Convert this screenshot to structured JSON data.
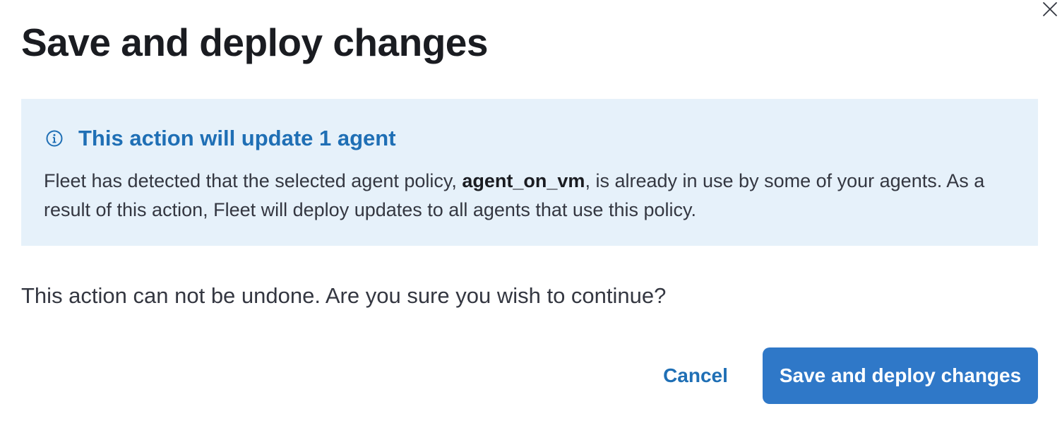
{
  "modal": {
    "title": "Save and deploy changes",
    "close_icon": "close-icon"
  },
  "callout": {
    "icon": "info-icon",
    "title": "This action will update 1 agent",
    "body_before": "Fleet has detected that the selected agent policy, ",
    "policy_name": "agent_on_vm",
    "body_after": ", is already in use by some of your agents. As a result of this action, Fleet will deploy updates to all agents that use this policy.",
    "background_color": "#e6f1fa",
    "title_color": "#1f6fb5"
  },
  "confirm_text": "This action can not be undone. Are you sure you wish to continue?",
  "footer": {
    "cancel_label": "Cancel",
    "confirm_label": "Save and deploy changes",
    "primary_color": "#2f78c8"
  }
}
